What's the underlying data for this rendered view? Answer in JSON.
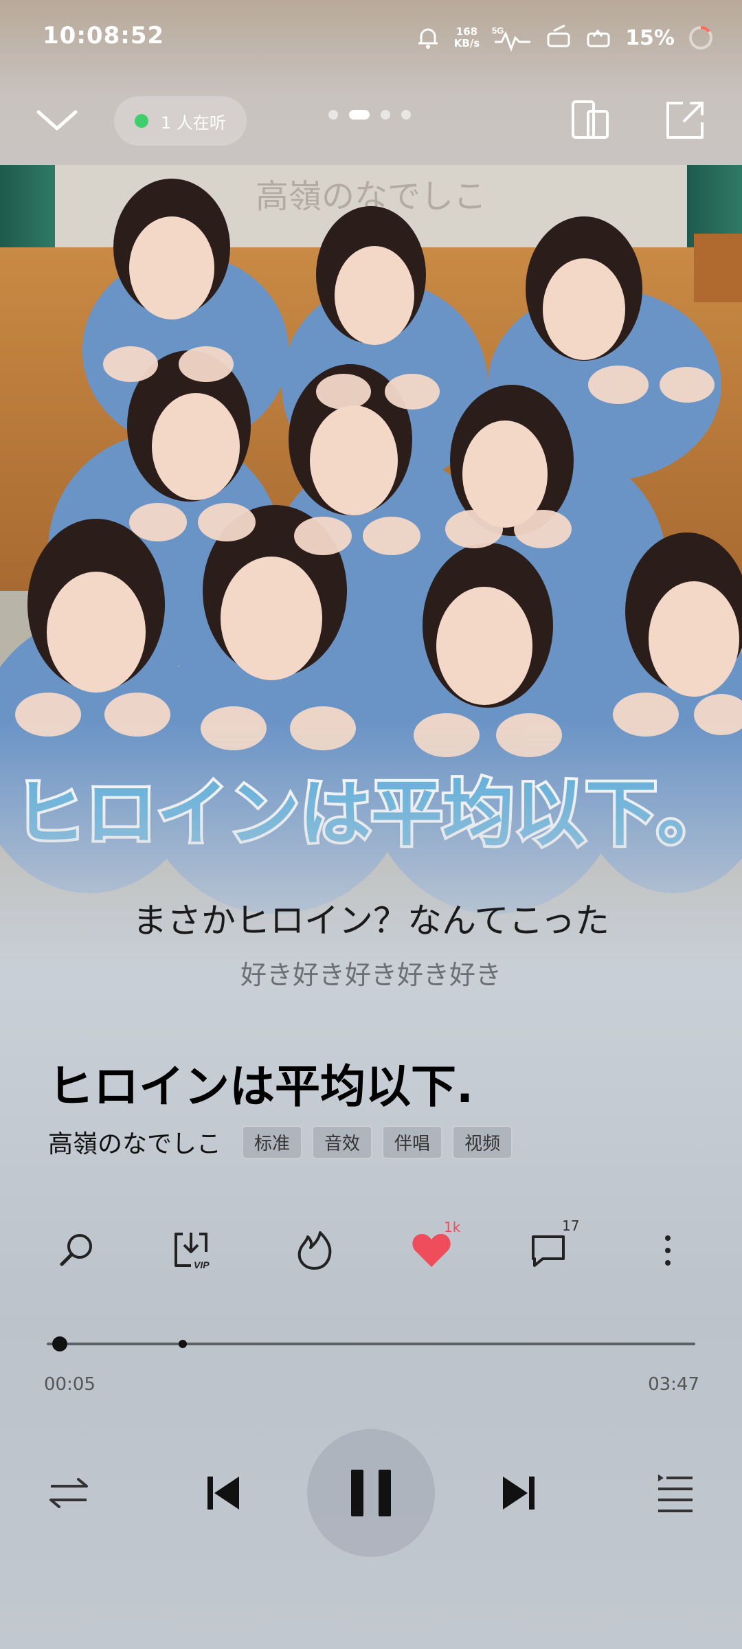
{
  "status_bar": {
    "time": "10:08:52",
    "net_speed_value": "168",
    "net_speed_unit": "KB/s",
    "signal": "5G",
    "battery": "15%"
  },
  "top_nav": {
    "listeners": "1 人在听",
    "page_count": 4,
    "active_page": 2
  },
  "artwork": {
    "overlay_artist": "高嶺のなでしこ",
    "overlay_title": "ヒロインは平均以下。"
  },
  "lyrics": {
    "current": "まさかヒロイン？なんてこった",
    "next": "好き好き好き好き好き"
  },
  "song": {
    "title": "ヒロインは平均以下.",
    "artist": "高嶺のなでしこ",
    "tags": [
      "标准",
      "音效",
      "伴唱",
      "视频"
    ]
  },
  "actions": {
    "like_count": "1k",
    "comment_count": "17",
    "like_color": "#ef4c5c"
  },
  "playback": {
    "current_time": "00:05",
    "total_time": "03:47",
    "progress_fraction": 0.02,
    "buffered_fraction": 0.21
  },
  "icons": [
    "bell-icon",
    "wifi-signal-icon",
    "battery-icon",
    "collapse-icon",
    "device-switch-icon",
    "share-icon",
    "search-icon",
    "download-vip-icon",
    "flame-icon",
    "heart-icon",
    "comment-icon",
    "more-icon",
    "shuffle-icon",
    "previous-icon",
    "pause-icon",
    "next-icon",
    "playlist-icon"
  ]
}
